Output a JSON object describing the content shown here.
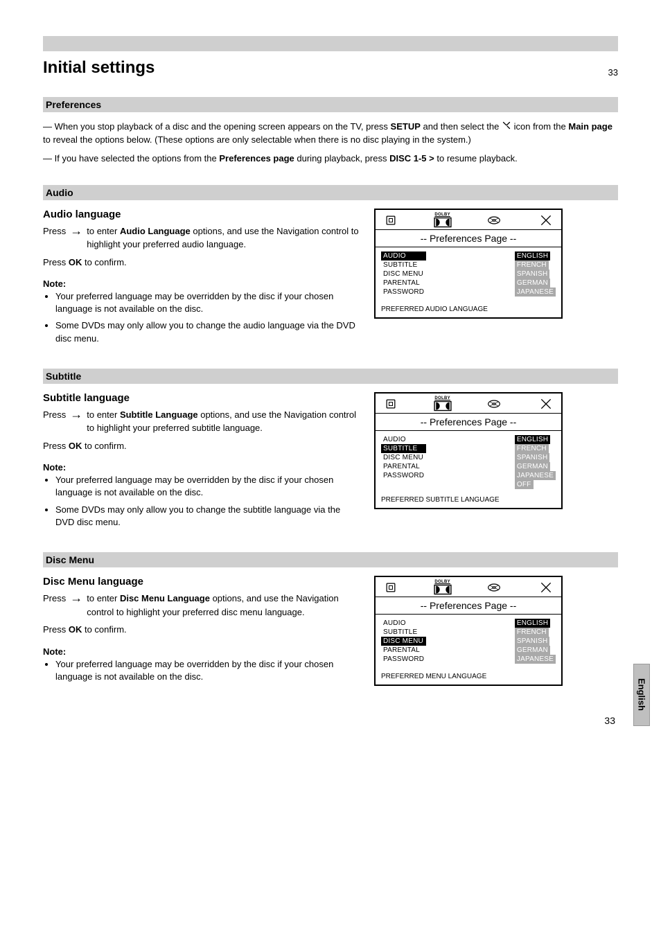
{
  "mainTitle": "Initial settings",
  "topPageNum": "33",
  "section": {
    "preferences": {
      "heading": "Preferences",
      "intro_lead": "— When you stop playback of a disc and the opening screen appears on the TV, press ",
      "intro_bold_setup": "SETUP",
      "intro_mid": " and then select the ",
      "intro_tool_icon": " ",
      "intro_after_icon": "icon from the ",
      "intro_bold_main": "Main page",
      "intro_tail": " to reveal the options below. (These options are only selectable when there is no disc playing in the system.)",
      "intro_note_prefix": "— If you have selected the options from the ",
      "intro_note_bold": "Preferences page",
      "intro_note_mid": " during playback, press ",
      "intro_note_key": "DISC 1-5 >",
      "intro_note_tail": " to resume playback."
    },
    "audio": {
      "title": "Audio",
      "subheading": "Audio language",
      "instr1a": "Press ",
      "arrow": "→",
      "instr1b": " to enter ",
      "instr1c_bold": "Audio Language",
      "instr1d": " options, and use the Navigation control to highlight your preferred audio language.",
      "instr2a": "Press ",
      "instr2b_bold": "OK",
      "instr2c": " to confirm.",
      "note_label": "Note:",
      "notes": [
        "Your preferred language may be overridden by the disc if your chosen language is not available on the disc.",
        "Some DVDs may only allow you to change the audio language via the DVD disc menu."
      ]
    },
    "subtitle": {
      "title": "Subtitle",
      "subheading": "Subtitle language",
      "instr1a": "Press ",
      "arrow": "→",
      "instr1b": " to enter ",
      "instr1c_bold": "Subtitle Language",
      "instr1d": " options, and use the Navigation control to highlight your preferred subtitle language.",
      "instr2a": "Press ",
      "instr2b_bold": "OK",
      "instr2c": " to confirm.",
      "note_label": "Note:",
      "notes": [
        "Your preferred language may be overridden by the disc if your chosen language is not available on the disc.",
        "Some DVDs may only allow you to change the subtitle language via the DVD disc menu."
      ]
    },
    "discmenu": {
      "title": "Disc Menu",
      "subheading": "Disc Menu language",
      "instr1a": "Press ",
      "arrow": "→",
      "instr1b": " to enter ",
      "instr1c_bold": "Disc Menu Language",
      "instr1d": " options, and use the Navigation control to highlight your preferred disc menu language.",
      "instr2a": "Press ",
      "instr2b_bold": "OK",
      "instr2c": " to confirm.",
      "note_label": "Note:",
      "notes": [
        "Your preferred language may be overridden by the disc if your chosen language is not available on the disc."
      ]
    }
  },
  "osd": {
    "title": "-- Preferences  Page --",
    "dolbyLabel": "DOLBY",
    "menuItems": [
      "AUDIO",
      "SUBTITLE",
      "DISC MENU",
      "PARENTAL",
      "PASSWORD"
    ],
    "langs5": [
      "ENGLISH",
      "FRENCH",
      "SPANISH",
      "GERMAN",
      "JAPANESE"
    ],
    "langs6": [
      "ENGLISH",
      "FRENCH",
      "SPANISH",
      "GERMAN",
      "JAPANESE",
      "OFF"
    ],
    "footerAudio": "PREFERRED AUDIO LANGUAGE",
    "footerSubtitle": "PREFERRED SUBTITLE LANGUAGE",
    "footerMenu": "PREFERRED MENU LANGUAGE"
  },
  "sideTab": "English",
  "pageBottom": "33"
}
